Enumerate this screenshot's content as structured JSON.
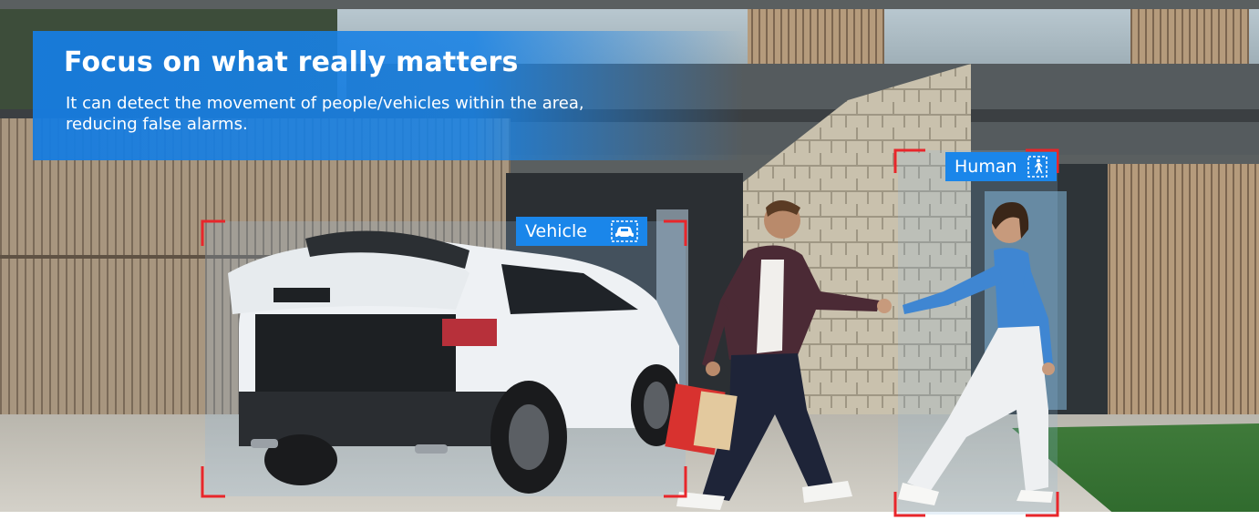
{
  "headline": "Focus on what really matters",
  "description": "It can detect the movement of people/vehicles within the area, reducing false alarms.",
  "detections": {
    "vehicle": {
      "label": "Vehicle",
      "icon": "car-icon"
    },
    "human": {
      "label": "Human",
      "icon": "walking-person-icon"
    }
  },
  "colors": {
    "accent_blue": "#1a86ea",
    "detection_red": "#e8262b",
    "banner_blue": "#167ce0"
  }
}
